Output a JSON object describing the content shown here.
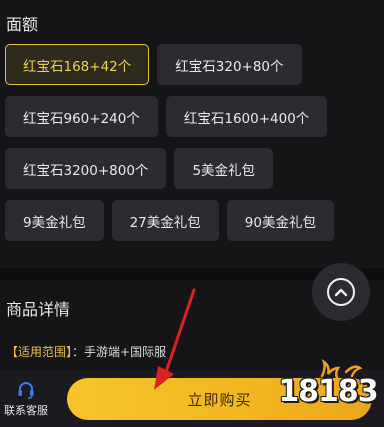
{
  "face_value": {
    "title": "面额",
    "options": [
      {
        "label": "红宝石168+42个",
        "selected": true
      },
      {
        "label": "红宝石320+80个",
        "selected": false
      },
      {
        "label": "红宝石960+240个",
        "selected": false
      },
      {
        "label": "红宝石1600+400个",
        "selected": false
      },
      {
        "label": "红宝石3200+800个",
        "selected": false
      },
      {
        "label": "5美金礼包",
        "selected": false
      },
      {
        "label": "9美金礼包",
        "selected": false
      },
      {
        "label": "27美金礼包",
        "selected": false
      },
      {
        "label": "90美金礼包",
        "selected": false
      }
    ]
  },
  "details": {
    "title": "商品详情",
    "scope_key": "【适用范围】",
    "scope_sep": "：",
    "scope_value": "手游端+国际服"
  },
  "bottom_bar": {
    "service_label": "联系客服",
    "buy_label": "立即购买"
  },
  "watermark": {
    "text": "18183"
  },
  "colors": {
    "accent_gold": "#e3c24a",
    "buy_gradient_start": "#f6c42a",
    "buy_gradient_end": "#eba61b",
    "annotation_arrow": "#e0201f",
    "service_icon": "#3a7bea"
  },
  "icons": [
    "back-to-top-icon",
    "headset-icon",
    "annotation-arrow"
  ]
}
